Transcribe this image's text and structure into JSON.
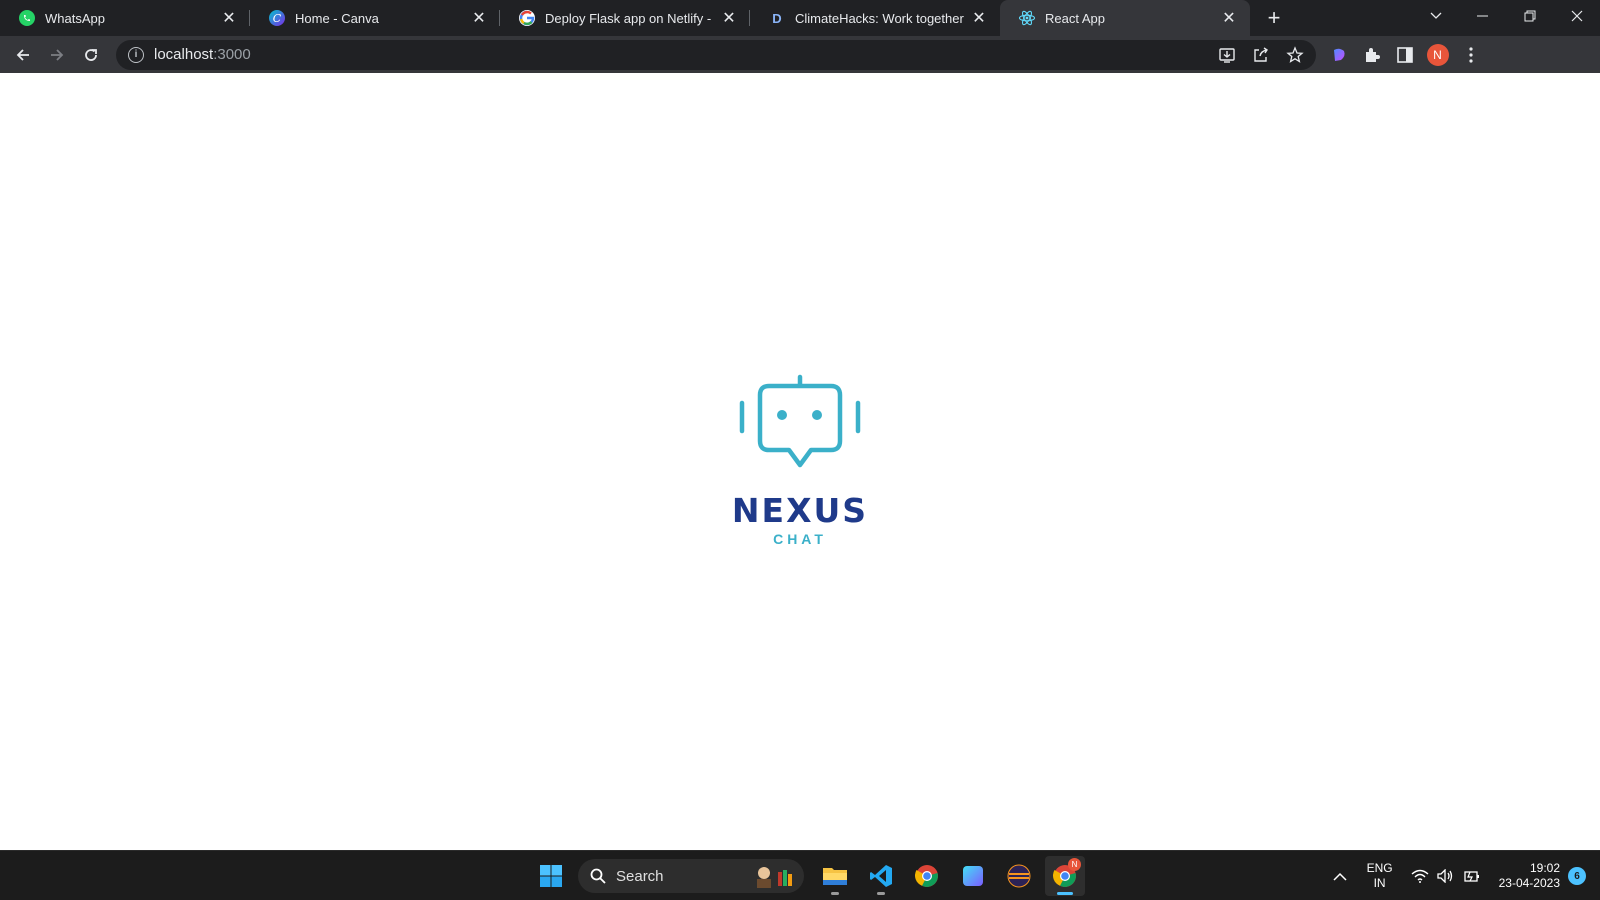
{
  "browser": {
    "tabs": [
      {
        "title": "WhatsApp",
        "icon": "whatsapp-icon",
        "active": false
      },
      {
        "title": "Home - Canva",
        "icon": "canva-icon",
        "active": false
      },
      {
        "title": "Deploy Flask app on Netlify - Go",
        "icon": "google-icon",
        "active": false
      },
      {
        "title": "ClimateHacks: Work together to s",
        "icon": "devpost-icon",
        "active": false
      },
      {
        "title": "React App",
        "icon": "react-icon",
        "active": true
      }
    ],
    "address": {
      "host": "localhost",
      "port": ":3000"
    },
    "profile_initial": "N"
  },
  "page": {
    "logo_title": "NEXUS",
    "logo_subtitle": "CHAT",
    "colors": {
      "logo_title": "#1f3a8a",
      "logo_icon": "#3bb0c9"
    }
  },
  "taskbar": {
    "search_label": "Search",
    "apps": [
      "start-icon",
      "file-explorer-icon",
      "vscode-icon",
      "chrome-icon",
      "app-icon",
      "eclipse-icon",
      "chrome-profile-icon"
    ],
    "chrome_badge": "N",
    "language": {
      "line1": "ENG",
      "line2": "IN"
    },
    "time": "19:02",
    "date": "23-04-2023",
    "notification_count": "6"
  }
}
